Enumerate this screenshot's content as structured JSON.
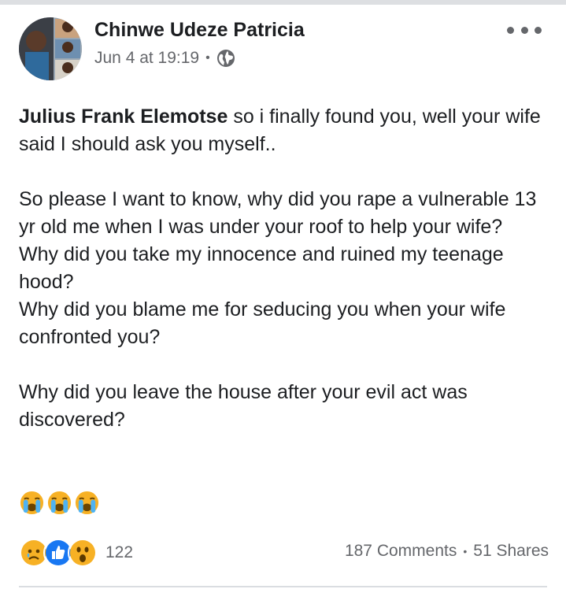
{
  "post": {
    "author": "Chinwe Udeze Patricia",
    "timestamp": "Jun 4 at 19:19",
    "separator": "•",
    "audience_icon": "globe-icon",
    "more_icon": "more-options-icon",
    "tagged_name": "Julius Frank Elemotse",
    "paragraph_1_rest": " so i finally found you, well your wife said I should ask you myself..",
    "paragraph_2": [
      "So please I want to know, why did you rape a vulnerable 13 yr old me when I was under your roof to help your wife?",
      "Why did you take my innocence and ruined my teenage hood?",
      "Why did you blame me for seducing you when your wife confronted you?"
    ],
    "paragraph_3": "Why did you leave the house after your evil act was discovered?",
    "emojis": [
      "loudly-crying-face",
      "loudly-crying-face",
      "loudly-crying-face"
    ]
  },
  "footer": {
    "reactions": [
      "sad-reaction-icon",
      "like-reaction-icon",
      "wow-reaction-icon"
    ],
    "reaction_count": "122",
    "comments": "187 Comments",
    "shares": "51 Shares",
    "separator": "•"
  },
  "colors": {
    "text": "#1c1e21",
    "secondary": "#65676b",
    "like_blue": "#1877f2",
    "emoji_yellow": "#f7b125"
  }
}
